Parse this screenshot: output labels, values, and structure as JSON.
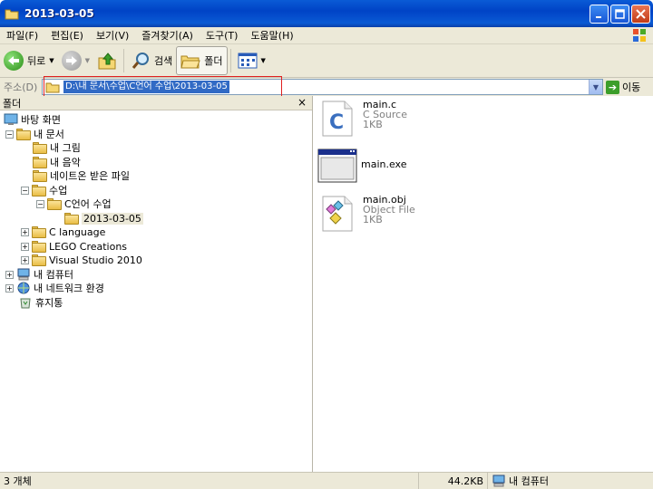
{
  "window": {
    "title": "2013-03-05"
  },
  "menu": [
    "파일(F)",
    "편집(E)",
    "보기(V)",
    "즐겨찾기(A)",
    "도구(T)",
    "도움말(H)"
  ],
  "toolbar": {
    "back": "뒤로",
    "search": "검색",
    "folders": "폴더"
  },
  "address": {
    "label": "주소(D)",
    "value": "D:\\내 문서\\수업\\C언어 수업\\2013-03-05",
    "go": "이동"
  },
  "folders_pane": {
    "title": "폴더",
    "close": "×"
  },
  "tree": [
    {
      "label": "바탕 화면"
    },
    {
      "label": "내 문서"
    },
    {
      "label": "내 그림"
    },
    {
      "label": "내 음악"
    },
    {
      "label": "네이트온 받은 파일"
    },
    {
      "label": "수업"
    },
    {
      "label": "C언어 수업"
    },
    {
      "label": "2013-03-05"
    },
    {
      "label": "C language"
    },
    {
      "label": "LEGO Creations"
    },
    {
      "label": "Visual Studio 2010"
    },
    {
      "label": "내 컴퓨터"
    },
    {
      "label": "내 네트워크 환경"
    },
    {
      "label": "휴지통"
    }
  ],
  "files": [
    {
      "name": "main.c",
      "type": "C Source",
      "size": "1KB"
    },
    {
      "name": "main.exe",
      "type": "",
      "size": ""
    },
    {
      "name": "main.obj",
      "type": "Object File",
      "size": "1KB"
    }
  ],
  "status": {
    "count": "3 개체",
    "size": "44.2KB",
    "location": "내 컴퓨터"
  }
}
